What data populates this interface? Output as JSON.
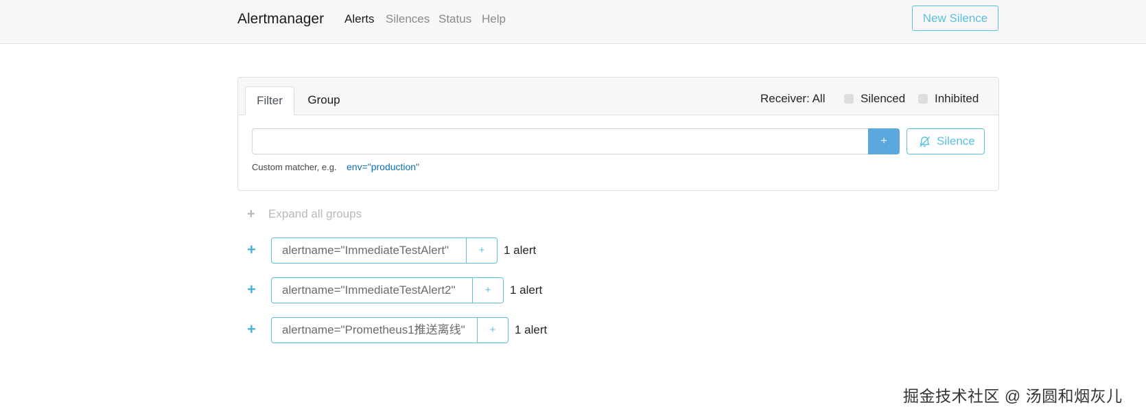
{
  "navbar": {
    "brand": "Alertmanager",
    "links": [
      {
        "label": "Alerts",
        "active": true
      },
      {
        "label": "Silences",
        "active": false
      },
      {
        "label": "Status",
        "active": false
      },
      {
        "label": "Help",
        "active": false
      }
    ],
    "new_silence_label": "New Silence"
  },
  "filter_panel": {
    "tabs": [
      {
        "label": "Filter",
        "active": true
      },
      {
        "label": "Group",
        "active": false
      }
    ],
    "receiver_label": "Receiver: All",
    "silenced_label": "Silenced",
    "silenced_checked": false,
    "inhibited_label": "Inhibited",
    "inhibited_checked": false,
    "input_value": "",
    "input_placeholder": "",
    "add_button_label": "+",
    "silence_button_label": "Silence",
    "silence_button_icon": "bell-slash-icon",
    "hint_text": "Custom matcher, e.g.",
    "hint_example": "env=\"production\""
  },
  "expand_all": {
    "icon": "plus-icon",
    "label": "Expand all groups"
  },
  "groups": [
    {
      "matcher": "alertname=\"ImmediateTestAlert\"",
      "add_label": "+",
      "count": "1 alert"
    },
    {
      "matcher": "alertname=\"ImmediateTestAlert2\"",
      "add_label": "+",
      "count": "1 alert"
    },
    {
      "matcher": "alertname=\"Prometheus1推送离线\"",
      "add_label": "+",
      "count": "1 alert"
    }
  ],
  "colors": {
    "accent": "#5bc0de",
    "primary_button": "#5ba7e0",
    "link": "#0b6fb4",
    "navbar_bg": "#f7f7f7"
  },
  "watermark": "掘金技术社区 @ 汤圆和烟灰儿"
}
